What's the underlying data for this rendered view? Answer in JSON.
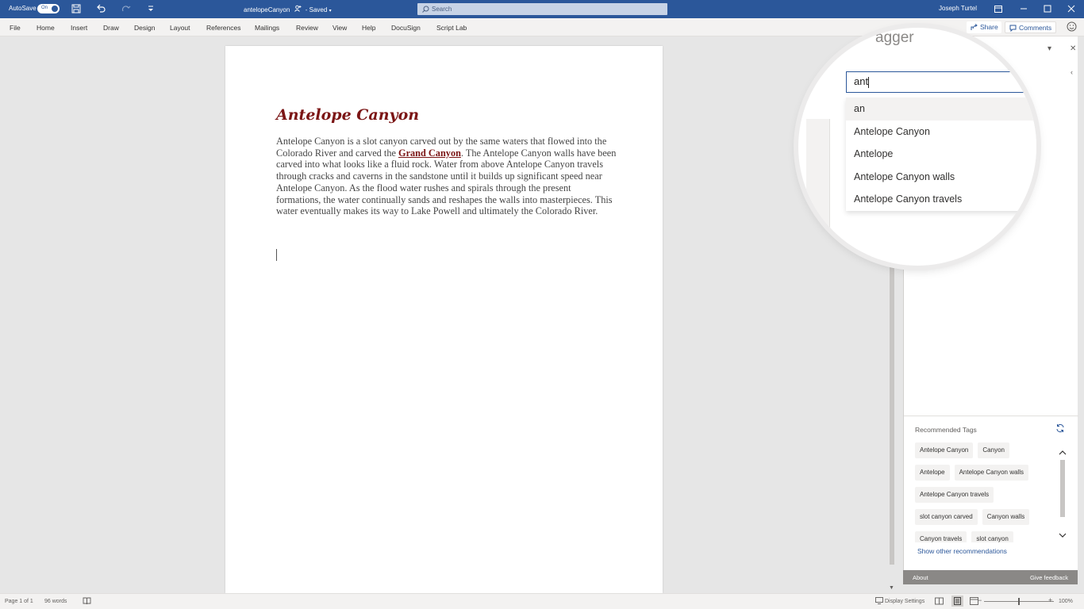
{
  "titlebar": {
    "autosave_label": "AutoSave",
    "autosave_state": "On",
    "doc_name": "antelopeCanyon",
    "save_status": "Saved",
    "search_placeholder": "Search",
    "username": "Joseph Turtel"
  },
  "ribbon": {
    "tabs": [
      "File",
      "Home",
      "Insert",
      "Draw",
      "Design",
      "Layout",
      "References",
      "Mailings",
      "Review",
      "View",
      "Help",
      "DocuSign",
      "Script Lab"
    ],
    "share_label": "Share",
    "comments_label": "Comments"
  },
  "document": {
    "heading": "Antelope Canyon",
    "body_before": "Antelope Canyon is a slot canyon carved out by the same waters that flowed into the Colorado River and carved the ",
    "body_link": "Grand Canyon",
    "body_after": ". The Antelope Canyon walls have been carved into what looks like a fluid rock. Water from above Antelope Canyon travels through cracks and caverns in the sandstone until it builds up significant speed near Antelope Canyon. As the flood water rushes and spirals through the present formations, the water continually sands and reshapes the walls into masterpieces. This water eventually makes its way to Lake Powell and ultimately the Colorado River."
  },
  "magnifier": {
    "pane_title_partial": "agger",
    "search_value": "ant",
    "suggestions": [
      "an",
      "Antelope Canyon",
      "Antelope",
      "Antelope Canyon walls",
      "Antelope Canyon travels"
    ]
  },
  "taskpane": {
    "recommended_title": "Recommended Tags",
    "tag_rows": [
      [
        "Antelope Canyon",
        "Canyon"
      ],
      [
        "Antelope",
        "Antelope Canyon walls"
      ],
      [
        "Antelope Canyon travels"
      ],
      [
        "slot canyon carved",
        "Canyon walls"
      ],
      [
        "Canyon travels",
        "slot canyon"
      ]
    ],
    "show_other": "Show other recommendations",
    "footer_about": "About",
    "footer_feedback": "Give feedback"
  },
  "statusbar": {
    "page": "Page 1 of 1",
    "words": "96 words",
    "display_settings": "Display Settings",
    "zoom": "100%"
  },
  "colors": {
    "brand": "#2b579a",
    "heading": "#7b1515"
  }
}
